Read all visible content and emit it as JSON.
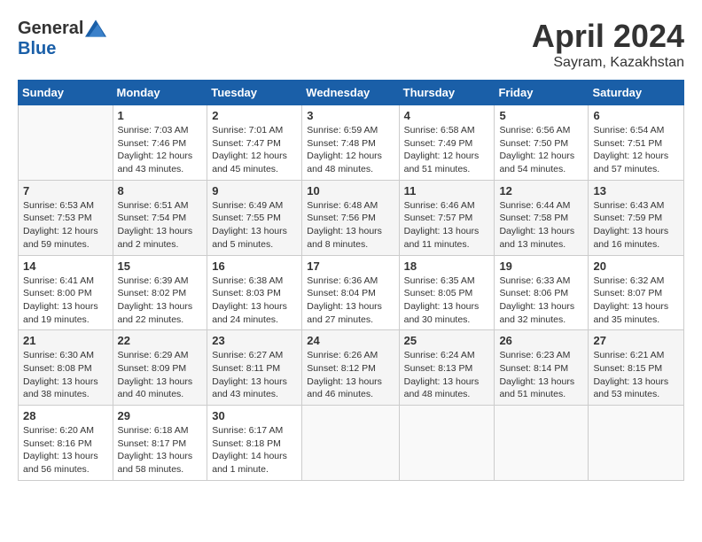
{
  "header": {
    "logo_general": "General",
    "logo_blue": "Blue",
    "month": "April 2024",
    "location": "Sayram, Kazakhstan"
  },
  "days_of_week": [
    "Sunday",
    "Monday",
    "Tuesday",
    "Wednesday",
    "Thursday",
    "Friday",
    "Saturday"
  ],
  "weeks": [
    [
      {
        "day": "",
        "info": ""
      },
      {
        "day": "1",
        "info": "Sunrise: 7:03 AM\nSunset: 7:46 PM\nDaylight: 12 hours\nand 43 minutes."
      },
      {
        "day": "2",
        "info": "Sunrise: 7:01 AM\nSunset: 7:47 PM\nDaylight: 12 hours\nand 45 minutes."
      },
      {
        "day": "3",
        "info": "Sunrise: 6:59 AM\nSunset: 7:48 PM\nDaylight: 12 hours\nand 48 minutes."
      },
      {
        "day": "4",
        "info": "Sunrise: 6:58 AM\nSunset: 7:49 PM\nDaylight: 12 hours\nand 51 minutes."
      },
      {
        "day": "5",
        "info": "Sunrise: 6:56 AM\nSunset: 7:50 PM\nDaylight: 12 hours\nand 54 minutes."
      },
      {
        "day": "6",
        "info": "Sunrise: 6:54 AM\nSunset: 7:51 PM\nDaylight: 12 hours\nand 57 minutes."
      }
    ],
    [
      {
        "day": "7",
        "info": "Sunrise: 6:53 AM\nSunset: 7:53 PM\nDaylight: 12 hours\nand 59 minutes."
      },
      {
        "day": "8",
        "info": "Sunrise: 6:51 AM\nSunset: 7:54 PM\nDaylight: 13 hours\nand 2 minutes."
      },
      {
        "day": "9",
        "info": "Sunrise: 6:49 AM\nSunset: 7:55 PM\nDaylight: 13 hours\nand 5 minutes."
      },
      {
        "day": "10",
        "info": "Sunrise: 6:48 AM\nSunset: 7:56 PM\nDaylight: 13 hours\nand 8 minutes."
      },
      {
        "day": "11",
        "info": "Sunrise: 6:46 AM\nSunset: 7:57 PM\nDaylight: 13 hours\nand 11 minutes."
      },
      {
        "day": "12",
        "info": "Sunrise: 6:44 AM\nSunset: 7:58 PM\nDaylight: 13 hours\nand 13 minutes."
      },
      {
        "day": "13",
        "info": "Sunrise: 6:43 AM\nSunset: 7:59 PM\nDaylight: 13 hours\nand 16 minutes."
      }
    ],
    [
      {
        "day": "14",
        "info": "Sunrise: 6:41 AM\nSunset: 8:00 PM\nDaylight: 13 hours\nand 19 minutes."
      },
      {
        "day": "15",
        "info": "Sunrise: 6:39 AM\nSunset: 8:02 PM\nDaylight: 13 hours\nand 22 minutes."
      },
      {
        "day": "16",
        "info": "Sunrise: 6:38 AM\nSunset: 8:03 PM\nDaylight: 13 hours\nand 24 minutes."
      },
      {
        "day": "17",
        "info": "Sunrise: 6:36 AM\nSunset: 8:04 PM\nDaylight: 13 hours\nand 27 minutes."
      },
      {
        "day": "18",
        "info": "Sunrise: 6:35 AM\nSunset: 8:05 PM\nDaylight: 13 hours\nand 30 minutes."
      },
      {
        "day": "19",
        "info": "Sunrise: 6:33 AM\nSunset: 8:06 PM\nDaylight: 13 hours\nand 32 minutes."
      },
      {
        "day": "20",
        "info": "Sunrise: 6:32 AM\nSunset: 8:07 PM\nDaylight: 13 hours\nand 35 minutes."
      }
    ],
    [
      {
        "day": "21",
        "info": "Sunrise: 6:30 AM\nSunset: 8:08 PM\nDaylight: 13 hours\nand 38 minutes."
      },
      {
        "day": "22",
        "info": "Sunrise: 6:29 AM\nSunset: 8:09 PM\nDaylight: 13 hours\nand 40 minutes."
      },
      {
        "day": "23",
        "info": "Sunrise: 6:27 AM\nSunset: 8:11 PM\nDaylight: 13 hours\nand 43 minutes."
      },
      {
        "day": "24",
        "info": "Sunrise: 6:26 AM\nSunset: 8:12 PM\nDaylight: 13 hours\nand 46 minutes."
      },
      {
        "day": "25",
        "info": "Sunrise: 6:24 AM\nSunset: 8:13 PM\nDaylight: 13 hours\nand 48 minutes."
      },
      {
        "day": "26",
        "info": "Sunrise: 6:23 AM\nSunset: 8:14 PM\nDaylight: 13 hours\nand 51 minutes."
      },
      {
        "day": "27",
        "info": "Sunrise: 6:21 AM\nSunset: 8:15 PM\nDaylight: 13 hours\nand 53 minutes."
      }
    ],
    [
      {
        "day": "28",
        "info": "Sunrise: 6:20 AM\nSunset: 8:16 PM\nDaylight: 13 hours\nand 56 minutes."
      },
      {
        "day": "29",
        "info": "Sunrise: 6:18 AM\nSunset: 8:17 PM\nDaylight: 13 hours\nand 58 minutes."
      },
      {
        "day": "30",
        "info": "Sunrise: 6:17 AM\nSunset: 8:18 PM\nDaylight: 14 hours\nand 1 minute."
      },
      {
        "day": "",
        "info": ""
      },
      {
        "day": "",
        "info": ""
      },
      {
        "day": "",
        "info": ""
      },
      {
        "day": "",
        "info": ""
      }
    ]
  ]
}
